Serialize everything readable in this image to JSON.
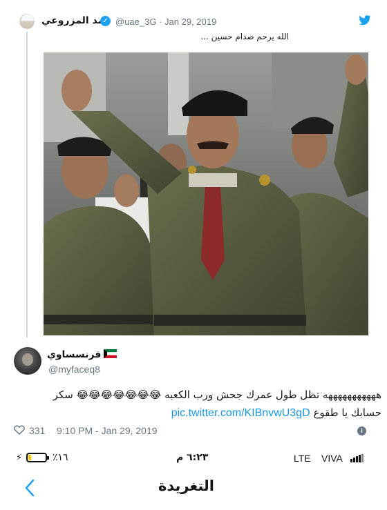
{
  "quoted_tweet": {
    "author_name": "حمد المزروعي",
    "handle": "@uae_3G",
    "date": "· Jan 29, 2019",
    "text": "الله يرحم صدام حسين ..."
  },
  "reply": {
    "author_name": "فرنسساوي",
    "handle": "@myfaceq8",
    "line1": "هههههههههههه تظل طول عمرك جحش ورب الكعبه 😂😂😂😂😂😂😂 سكر",
    "line2_text": "حسابك يا طقوع",
    "link": "pic.twitter.com/KIBnvwU3gD",
    "likes": "331",
    "timestamp": "9:10 PM - Jan 29, 2019"
  },
  "status_bar": {
    "charging_icon": "charging-bolt-icon",
    "battery_percent": "١٦٪",
    "battery_level": 0.16,
    "battery_color": "#f5c400",
    "time": "٦:٢٣ م",
    "network": "LTE",
    "carrier": "VIVA"
  },
  "nav": {
    "title": "التغريدة",
    "back_icon": "chevron-left-icon"
  },
  "colors": {
    "twitter_blue": "#1da1f2",
    "link_blue": "#1b95e0",
    "muted_gray": "#657786"
  }
}
